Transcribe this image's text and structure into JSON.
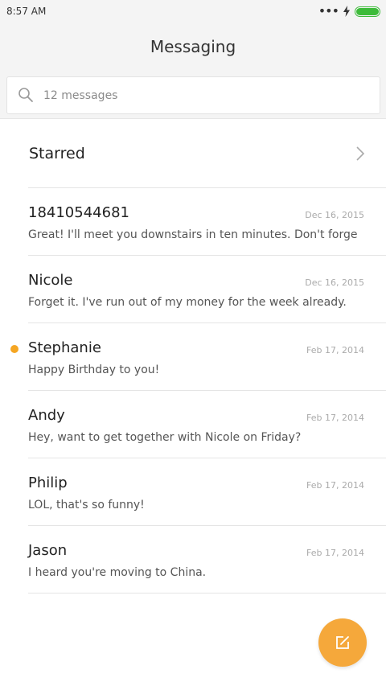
{
  "status_bar": {
    "time": "8:57 AM",
    "more": "•••"
  },
  "header": {
    "title": "Messaging"
  },
  "search": {
    "placeholder": "12 messages"
  },
  "starred": {
    "label": "Starred"
  },
  "conversations": [
    {
      "name": "18410544681",
      "date": "Dec 16, 2015",
      "preview": "Great! I'll meet you downstairs in ten minutes. Don't forge",
      "unread": false
    },
    {
      "name": "Nicole",
      "date": "Dec 16, 2015",
      "preview": "Forget it. I've run out of my money for the week already.",
      "unread": false
    },
    {
      "name": "Stephanie",
      "date": "Feb 17, 2014",
      "preview": "Happy Birthday to you!",
      "unread": true
    },
    {
      "name": "Andy",
      "date": "Feb 17, 2014",
      "preview": "Hey, want to get together with Nicole on Friday?",
      "unread": false
    },
    {
      "name": "Philip",
      "date": "Feb 17, 2014",
      "preview": "LOL, that's so funny!",
      "unread": false
    },
    {
      "name": "Jason",
      "date": "Feb 17, 2014",
      "preview": "I heard you're moving to China.",
      "unread": false
    }
  ],
  "colors": {
    "accent": "#f5a623",
    "battery": "#3dbb3a"
  },
  "icons": {
    "search": "search-icon",
    "chevron": "chevron-right-icon",
    "compose": "compose-icon"
  }
}
